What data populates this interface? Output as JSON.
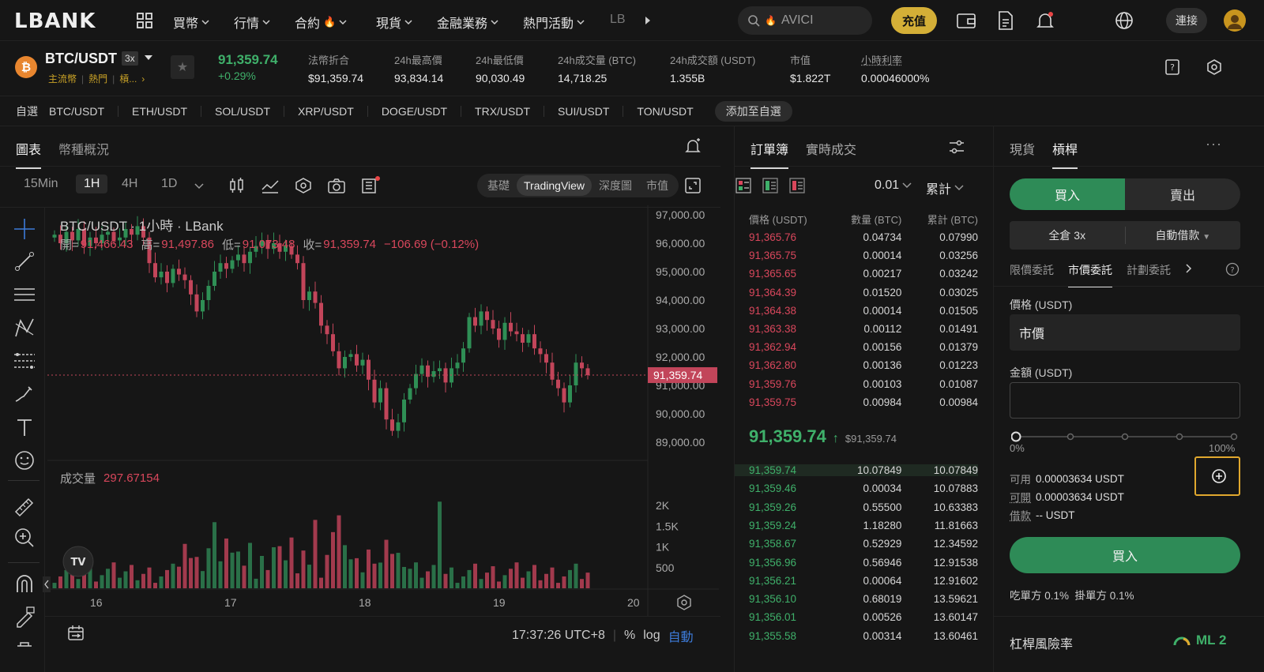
{
  "nav": {
    "logo": "LBANK",
    "items": [
      "買幣",
      "行情",
      "合約",
      "現貨",
      "金融業務",
      "熱門活動",
      "LB"
    ],
    "search_value": "AVICI",
    "deposit": "充值",
    "connect": "連接"
  },
  "ticker": {
    "pair": "BTC/USDT",
    "leverage": "3x",
    "tags": [
      "主流幣",
      "熱門",
      "槓..."
    ],
    "price": "91,359.74",
    "change": "+0.29%",
    "stats": [
      {
        "label": "法幣折合",
        "value": "$91,359.74"
      },
      {
        "label": "24h最高價",
        "value": "93,834.14"
      },
      {
        "label": "24h最低價",
        "value": "90,030.49"
      },
      {
        "label": "24h成交量 (BTC)",
        "value": "14,718.25"
      },
      {
        "label": "24h成交額 (USDT)",
        "value": "1.355B"
      },
      {
        "label": "市值",
        "value": "$1.822T"
      },
      {
        "label": "小時利率",
        "value": "0.00046000%"
      }
    ]
  },
  "favorites": {
    "label": "自選",
    "pairs": [
      "BTC/USDT",
      "ETH/USDT",
      "SOL/USDT",
      "XRP/USDT",
      "DOGE/USDT",
      "TRX/USDT",
      "SUI/USDT",
      "TON/USDT"
    ],
    "add": "添加至自選"
  },
  "chart": {
    "tabs": [
      "圖表",
      "幣種概況"
    ],
    "timeframes": [
      "15Min",
      "1H",
      "4H",
      "1D"
    ],
    "active_tf": "1H",
    "views": [
      "基礎",
      "TradingView",
      "深度圖",
      "市值"
    ],
    "title": "BTC/USDT · 1小時 · LBank",
    "ohlc": {
      "open_label": "開=",
      "open": "91,466.43",
      "high_label": "高=",
      "high": "91,497.86",
      "low_label": "低=",
      "low": "91,073.48",
      "close_label": "收=",
      "close": "91,359.74",
      "chg": "−106.69 (−0.12%)"
    },
    "price_ticks": [
      "97,000.00",
      "96,000.00",
      "95,000.00",
      "94,000.00",
      "93,000.00",
      "92,000.00",
      "91,000.00",
      "90,000.00",
      "89,000.00"
    ],
    "current_price": "91,359.74",
    "volume_label": "成交量",
    "volume_value": "297.67154",
    "volume_ticks": [
      "2K",
      "1.5K",
      "1K",
      "500"
    ],
    "date_ticks": [
      "16",
      "17",
      "18",
      "19",
      "20"
    ],
    "time": "17:37:26 UTC+8",
    "pct": "%",
    "log": "log",
    "auto": "自動"
  },
  "orderbook": {
    "tabs": [
      "訂單簿",
      "實時成交"
    ],
    "precision": "0.01",
    "mode": "累計",
    "cols": [
      "價格 (USDT)",
      "數量 (BTC)",
      "累計 (BTC)"
    ],
    "asks": [
      [
        "91,365.76",
        "0.04734",
        "0.07990"
      ],
      [
        "91,365.75",
        "0.00014",
        "0.03256"
      ],
      [
        "91,365.65",
        "0.00217",
        "0.03242"
      ],
      [
        "91,364.39",
        "0.01520",
        "0.03025"
      ],
      [
        "91,364.38",
        "0.00014",
        "0.01505"
      ],
      [
        "91,363.38",
        "0.00112",
        "0.01491"
      ],
      [
        "91,362.94",
        "0.00156",
        "0.01379"
      ],
      [
        "91,362.80",
        "0.00136",
        "0.01223"
      ],
      [
        "91,359.76",
        "0.00103",
        "0.01087"
      ],
      [
        "91,359.75",
        "0.00984",
        "0.00984"
      ]
    ],
    "mid": "91,359.74",
    "mid_fiat": "$91,359.74",
    "bids": [
      [
        "91,359.74",
        "10.07849",
        "10.07849"
      ],
      [
        "91,359.46",
        "0.00034",
        "10.07883"
      ],
      [
        "91,359.26",
        "0.55500",
        "10.63383"
      ],
      [
        "91,359.24",
        "1.18280",
        "11.81663"
      ],
      [
        "91,358.67",
        "0.52929",
        "12.34592"
      ],
      [
        "91,356.96",
        "0.56946",
        "12.91538"
      ],
      [
        "91,356.21",
        "0.00064",
        "12.91602"
      ],
      [
        "91,356.10",
        "0.68019",
        "13.59621"
      ],
      [
        "91,356.01",
        "0.00526",
        "13.60147"
      ],
      [
        "91,355.58",
        "0.00314",
        "13.60461"
      ]
    ]
  },
  "form": {
    "tabs": [
      "現貨",
      "槓桿"
    ],
    "buy": "買入",
    "sell": "賣出",
    "margin_mode": "全倉 3x",
    "borrow_mode": "自動借款",
    "order_types": [
      "限價委託",
      "市價委託",
      "計劃委託"
    ],
    "price_label": "價格 (USDT)",
    "price_value": "市價",
    "amount_label": "金額 (USDT)",
    "slider_min": "0%",
    "slider_max": "100%",
    "available_label": "可用",
    "available": "0.00003634 USDT",
    "open_label": "可開",
    "open": "0.00003634 USDT",
    "borrow_label": "借款",
    "borrow": "-- USDT",
    "submit": "買入",
    "fees": "吃單方 0.1%  掛單方 0.1%",
    "risk_label": "杠桿風險率",
    "risk_value": "ML 2"
  }
}
